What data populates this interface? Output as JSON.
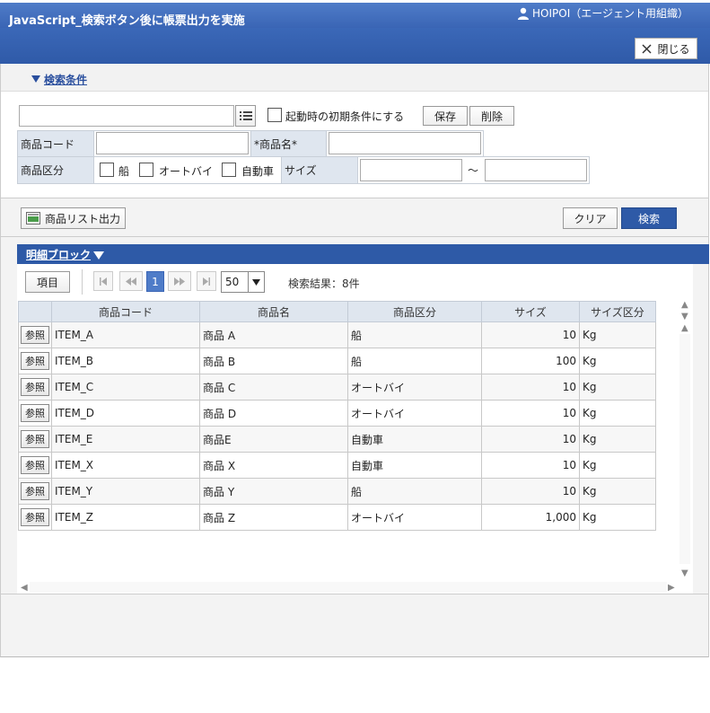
{
  "header": {
    "user_name": "HOIPOI（エージェント用組織）",
    "title": "JavaScript_検索ボタン後に帳票出力を実施",
    "close_label": "閉じる"
  },
  "conditions": {
    "toggle_label": "検索条件",
    "startup_checkbox_label": "起動時の初期条件にする",
    "save_label": "保存",
    "delete_label": "削除",
    "product_code_label": "商品コード",
    "product_name_label": "*商品名*",
    "category_label": "商品区分",
    "category_options": [
      "船",
      "オートバイ",
      "自動車"
    ],
    "size_label": "サイズ",
    "range_sep": "～"
  },
  "actions": {
    "export_label": "商品リスト出力",
    "clear_label": "クリア",
    "search_label": "検索"
  },
  "detail": {
    "toggle_label": "明細ブロック",
    "column_button_label": "項目",
    "current_page": "1",
    "page_size": "50",
    "result_text": "検索結果：8件",
    "columns": [
      "商品コード",
      "商品名",
      "商品区分",
      "サイズ",
      "サイズ区分"
    ],
    "ref_label": "参照",
    "rows": [
      {
        "code": "ITEM_A",
        "name": "商品 A",
        "category": "船",
        "size": "10",
        "unit": "Kg"
      },
      {
        "code": "ITEM_B",
        "name": "商品 B",
        "category": "船",
        "size": "100",
        "unit": "Kg"
      },
      {
        "code": "ITEM_C",
        "name": "商品 C",
        "category": "オートバイ",
        "size": "10",
        "unit": "Kg"
      },
      {
        "code": "ITEM_D",
        "name": "商品 D",
        "category": "オートバイ",
        "size": "10",
        "unit": "Kg"
      },
      {
        "code": "ITEM_E",
        "name": "商品E",
        "category": "自動車",
        "size": "10",
        "unit": "Kg"
      },
      {
        "code": "ITEM_X",
        "name": "商品 X",
        "category": "自動車",
        "size": "10",
        "unit": "Kg"
      },
      {
        "code": "ITEM_Y",
        "name": "商品 Y",
        "category": "船",
        "size": "10",
        "unit": "Kg"
      },
      {
        "code": "ITEM_Z",
        "name": "商品 Z",
        "category": "オートバイ",
        "size": "1,000",
        "unit": "Kg"
      }
    ]
  },
  "colors": {
    "header_blue": "#3b68b8",
    "detail_blue": "#2e5aa7",
    "search_button": "#2e5aa7",
    "link_blue": "#2a4f9e"
  }
}
